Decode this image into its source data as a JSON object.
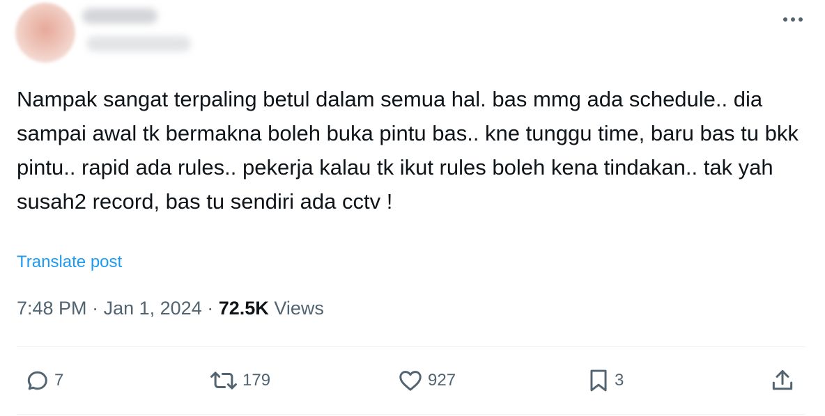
{
  "post": {
    "text": "Nampak sangat terpaling betul dalam semua hal. bas mmg ada schedule.. dia sampai awal tk bermakna boleh buka pintu bas.. kne tunggu time, baru bas tu bkk pintu.. rapid ada rules.. pekerja kalau tk ikut rules boleh kena tindakan.. tak yah susah2 record, bas tu sendiri ada cctv !",
    "translate_label": "Translate post",
    "time": "7:48 PM",
    "separator": "·",
    "date": "Jan 1, 2024",
    "views_count": "72.5K",
    "views_label": "Views"
  },
  "actions": {
    "replies": "7",
    "reposts": "179",
    "likes": "927",
    "bookmarks": "3"
  },
  "icons": {
    "more": "more-horizontal-icon",
    "reply": "reply-icon",
    "repost": "repost-icon",
    "like": "heart-icon",
    "bookmark": "bookmark-icon",
    "share": "share-icon"
  },
  "colors": {
    "text": "#0f1419",
    "secondary": "#536471",
    "link": "#1d9bf0",
    "divider": "#eff3f4"
  }
}
